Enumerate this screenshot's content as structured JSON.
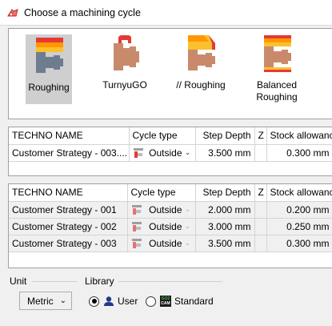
{
  "window": {
    "title": "Choose a machining cycle"
  },
  "cycles": [
    {
      "label": "Roughing",
      "selected": true
    },
    {
      "label": "TurnyuGO",
      "selected": false
    },
    {
      "label": "// Roughing",
      "selected": false
    },
    {
      "label_line1": "Balanced",
      "label_line2": "Roughing",
      "selected": false
    }
  ],
  "top_grid": {
    "headers": [
      "TECHNO NAME",
      "Cycle type",
      "Step Depth",
      "Z",
      "Stock allowance"
    ],
    "row": {
      "name": "Customer Strategy - 003....",
      "cycle_type": "Outside",
      "step_depth": "3.500 mm",
      "stock": "0.300 mm"
    }
  },
  "library_grid": {
    "headers": [
      "TECHNO NAME",
      "Cycle type",
      "Step Depth",
      "Z",
      "Stock allowance"
    ],
    "rows": [
      {
        "name": "Customer Strategy - 001",
        "cycle_type": "Outside",
        "step_depth": "2.000 mm",
        "stock": "0.200 mm"
      },
      {
        "name": "Customer Strategy - 002",
        "cycle_type": "Outside",
        "step_depth": "3.000 mm",
        "stock": "0.250 mm"
      },
      {
        "name": "Customer Strategy - 003",
        "cycle_type": "Outside",
        "step_depth": "3.500 mm",
        "stock": "0.300 mm"
      }
    ]
  },
  "footer": {
    "unit_label": "Unit",
    "unit_value": "Metric",
    "library_label": "Library",
    "user_label": "User",
    "standard_label": "Standard",
    "standard_badge_top": "GO2",
    "standard_badge_bottom": "CAM"
  },
  "colors": {
    "selection_bg": "#cfcfcf",
    "grid_border": "#a0a0a0",
    "accent_red": "#e53935",
    "accent_yellow": "#fbc02d",
    "part_gray": "#6d7d8f",
    "part_brown": "#c98a6b"
  }
}
